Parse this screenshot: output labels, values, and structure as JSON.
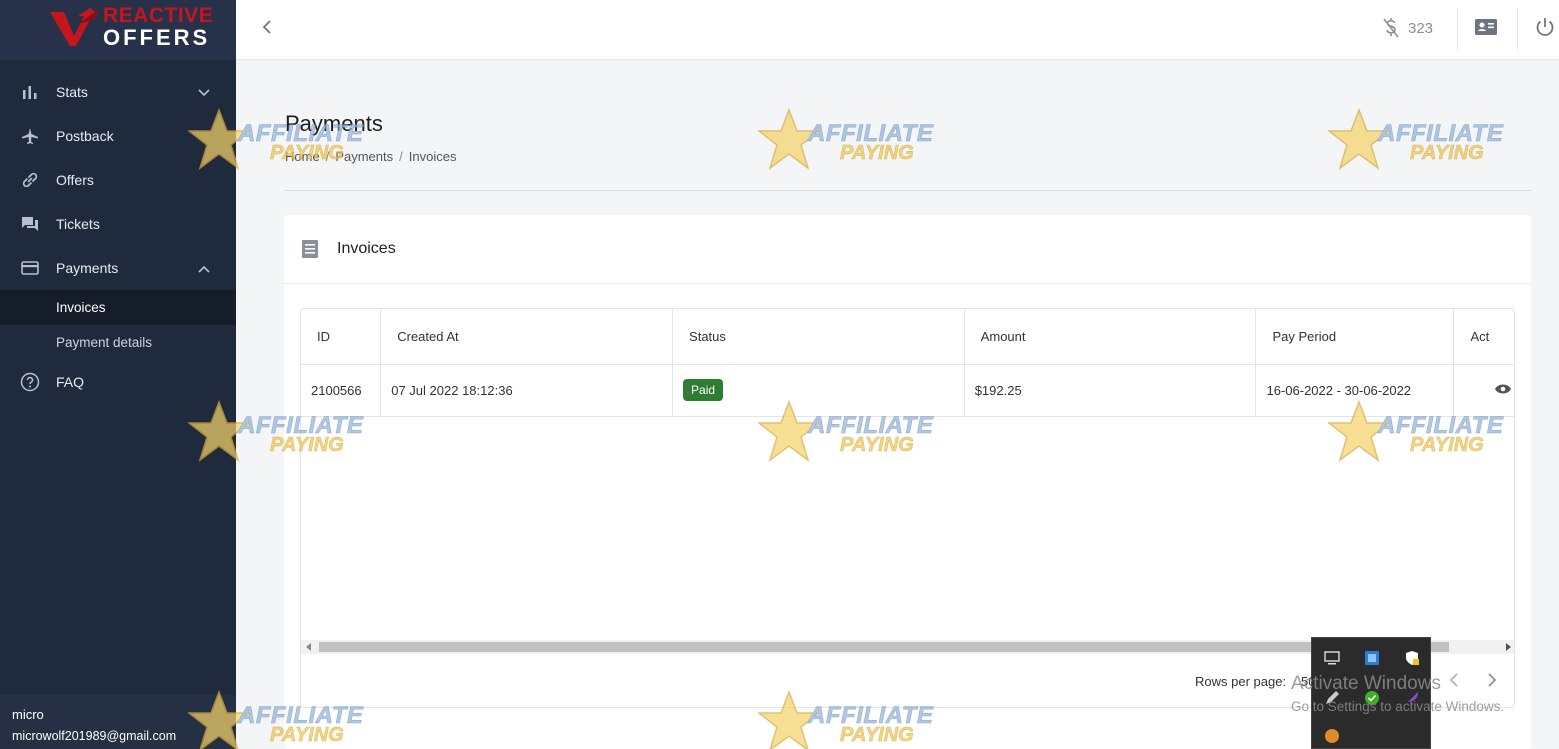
{
  "brand": {
    "line1": "REACTIVE",
    "line2": "OFFERS"
  },
  "sidebar": {
    "items": [
      {
        "label": "Stats",
        "icon": "bar-chart-icon"
      },
      {
        "label": "Postback",
        "icon": "airplane-icon"
      },
      {
        "label": "Offers",
        "icon": "link-icon"
      },
      {
        "label": "Tickets",
        "icon": "chat-icon"
      },
      {
        "label": "Payments",
        "icon": "credit-card-icon"
      },
      {
        "label": "FAQ",
        "icon": "help-circle-icon"
      }
    ],
    "sub_items": [
      {
        "label": "Invoices",
        "active": true
      },
      {
        "label": "Payment details",
        "active": false
      }
    ],
    "user": {
      "name": "micro",
      "email": "microwolf201989@gmail.com"
    }
  },
  "topbar": {
    "balance": "323",
    "balance_icon": "no-dollar-icon",
    "card_icon": "contact-card-icon",
    "power_icon": "power-icon"
  },
  "page": {
    "title": "Payments",
    "breadcrumb": [
      "Home",
      "Payments",
      "Invoices"
    ]
  },
  "panel": {
    "title": "Invoices",
    "columns": [
      "ID",
      "Created At",
      "Status",
      "Amount",
      "Pay Period",
      "Act"
    ],
    "rows": [
      {
        "id": "2100566",
        "created_at": "07 Jul 2022 18:12:36",
        "status": "Paid",
        "amount": "$192.25",
        "pay_period": "16-06-2022 - 30-06-2022"
      }
    ],
    "rows_per_page_label": "Rows per page:",
    "rows_per_page_value": "50"
  },
  "watermark": {
    "line1": "AFFILIATE",
    "line2": "PAYING"
  },
  "windows": {
    "activate_title": "Activate Windows",
    "activate_sub": "Go to Settings to activate Windows."
  },
  "colors": {
    "sidebar": "#1f2a3c",
    "paid_badge": "#2e7d32",
    "brand_red": "#c4161c"
  }
}
